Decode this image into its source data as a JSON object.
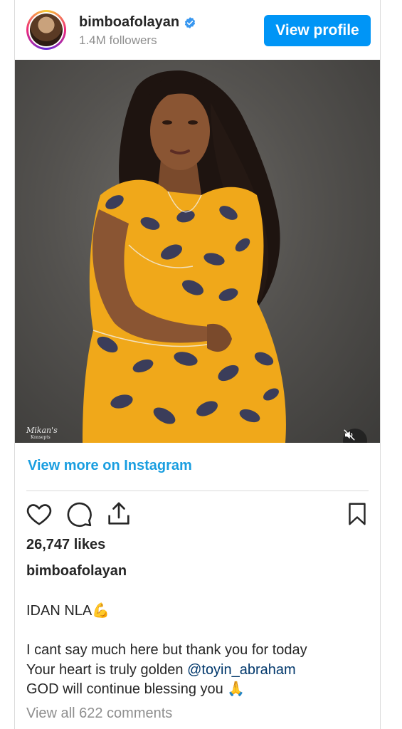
{
  "header": {
    "username": "bimboafolayan",
    "followers": "1.4M followers",
    "view_profile_label": "View profile",
    "verified_icon": "verified-badge-icon"
  },
  "media": {
    "watermark_name": "Mikan's",
    "watermark_sub": "Konsepts",
    "mute_icon": "speaker-muted-icon"
  },
  "links": {
    "view_more": "View more on Instagram"
  },
  "actions": {
    "like_icon": "heart-icon",
    "comment_icon": "comment-bubble-icon",
    "share_icon": "share-upload-icon",
    "save_icon": "bookmark-icon"
  },
  "stats": {
    "likes": "26,747 likes"
  },
  "caption": {
    "username": "bimboafolayan",
    "line1": "IDAN NLA💪",
    "line2": "I cant say much here but thank you for today",
    "line3_prefix": "Your heart is truly golden ",
    "mention": "@toyin_abraham",
    "line4": "GOD will continue blessing you 🙏"
  },
  "comments": {
    "view_all": "View all 622 comments"
  },
  "colors": {
    "accent_blue": "#0095f6",
    "link_blue": "#1a9ee0",
    "mention_blue": "#00376b",
    "muted_gray": "#8e8e8e"
  }
}
